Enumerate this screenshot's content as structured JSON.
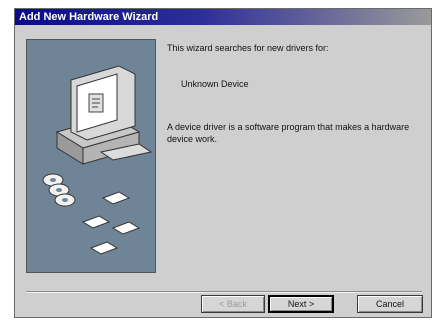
{
  "window": {
    "title": "Add New Hardware Wizard"
  },
  "content": {
    "intro": "This wizard searches for new drivers for:",
    "device_name": "Unknown Device",
    "description": "A device driver is a software program that makes a hardware device work."
  },
  "buttons": {
    "back": "< Back",
    "next": "Next >",
    "cancel": "Cancel"
  },
  "colors": {
    "title_bar": "#0a0a8a",
    "dialog_bg": "#cfcfcf",
    "illustration_bg": "#6f8496"
  }
}
